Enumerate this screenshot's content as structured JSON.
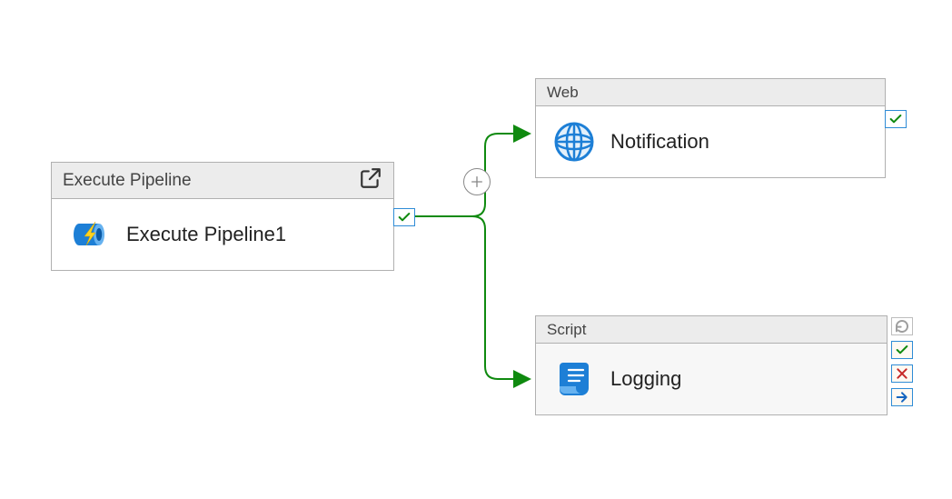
{
  "nodes": {
    "execute_pipeline": {
      "type_label": "Execute Pipeline",
      "activity_name": "Execute Pipeline1"
    },
    "web": {
      "type_label": "Web",
      "activity_name": "Notification"
    },
    "script": {
      "type_label": "Script",
      "activity_name": "Logging"
    }
  },
  "connectors": [
    {
      "from": "execute_pipeline",
      "to": "web",
      "condition": "success"
    },
    {
      "from": "execute_pipeline",
      "to": "script",
      "condition": "success"
    }
  ],
  "branch_handles": {
    "success": "success",
    "failure": "failure",
    "completion": "completion",
    "skip": "skip"
  },
  "colors": {
    "success_line": "#0f8a0f",
    "node_border": "#b0b0b0",
    "header_bg": "#ececec",
    "icon_blue": "#1d7fd6",
    "failure_red": "#c62828",
    "completion_blue": "#1565c0",
    "skip_gray": "#9e9e9e"
  }
}
